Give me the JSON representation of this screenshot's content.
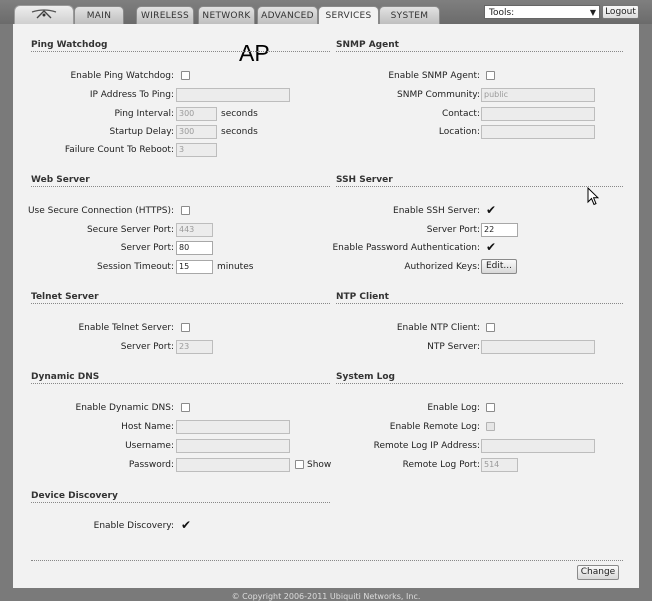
{
  "tabs": [
    "MAIN",
    "WIRELESS",
    "NETWORK",
    "ADVANCED",
    "SERVICES",
    "SYSTEM"
  ],
  "active_tab": "SERVICES",
  "tools": {
    "label": "Tools:"
  },
  "logout_label": "Logout",
  "ap_label": "AP",
  "ping": {
    "title": "Ping Watchdog",
    "enable_label": "Enable Ping Watchdog:",
    "ip_label": "IP Address To Ping:",
    "ip_value": "",
    "interval_label": "Ping Interval:",
    "interval_value": "300",
    "interval_unit": "seconds",
    "delay_label": "Startup Delay:",
    "delay_value": "300",
    "delay_unit": "seconds",
    "failure_label": "Failure Count To Reboot:",
    "failure_value": "3"
  },
  "snmp": {
    "title": "SNMP Agent",
    "enable_label": "Enable SNMP Agent:",
    "community_label": "SNMP Community:",
    "community_value": "public",
    "contact_label": "Contact:",
    "contact_value": "",
    "location_label": "Location:",
    "location_value": ""
  },
  "web": {
    "title": "Web Server",
    "https_label": "Use Secure Connection (HTTPS):",
    "secure_port_label": "Secure Server Port:",
    "secure_port_value": "443",
    "port_label": "Server Port:",
    "port_value": "80",
    "timeout_label": "Session Timeout:",
    "timeout_value": "15",
    "timeout_unit": "minutes"
  },
  "ssh": {
    "title": "SSH Server",
    "enable_label": "Enable SSH Server:",
    "port_label": "Server Port:",
    "port_value": "22",
    "password_auth_label": "Enable Password Authentication:",
    "keys_label": "Authorized Keys:",
    "edit_label": "Edit..."
  },
  "telnet": {
    "title": "Telnet Server",
    "enable_label": "Enable Telnet Server:",
    "port_label": "Server Port:",
    "port_value": "23"
  },
  "ntp": {
    "title": "NTP Client",
    "enable_label": "Enable NTP Client:",
    "server_label": "NTP Server:",
    "server_value": ""
  },
  "ddns": {
    "title": "Dynamic DNS",
    "enable_label": "Enable Dynamic DNS:",
    "host_label": "Host Name:",
    "host_value": "",
    "user_label": "Username:",
    "user_value": "",
    "pass_label": "Password:",
    "pass_value": "",
    "show_label": "Show"
  },
  "syslog": {
    "title": "System Log",
    "enable_label": "Enable Log:",
    "remote_label": "Enable Remote Log:",
    "remote_ip_label": "Remote Log IP Address:",
    "remote_ip_value": "",
    "remote_port_label": "Remote Log Port:",
    "remote_port_value": "514"
  },
  "discovery": {
    "title": "Device Discovery",
    "enable_label": "Enable Discovery:"
  },
  "change_label": "Change",
  "footer": "© Copyright 2006-2011 Ubiquiti Networks, Inc."
}
